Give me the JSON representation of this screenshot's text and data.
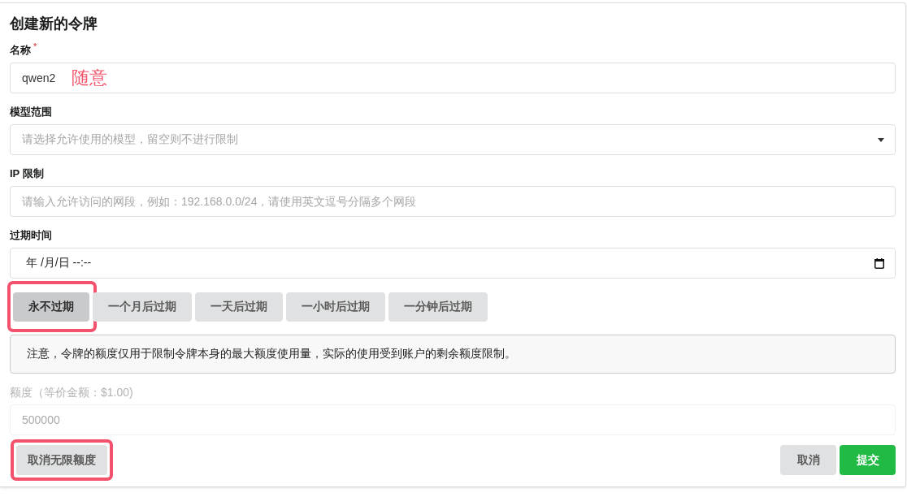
{
  "dialog": {
    "title": "创建新的令牌"
  },
  "fields": [
    {
      "kind": "text",
      "label": "名称",
      "required_mark": "*",
      "value": "qwen2",
      "annotation": "随意"
    },
    {
      "kind": "select",
      "label": "模型范围",
      "placeholder": "请选择允许使用的模型，留空则不进行限制"
    },
    {
      "kind": "text",
      "label": "IP 限制",
      "placeholder": "请输入允许访问的网段，例如：192.168.0.0/24，请使用英文逗号分隔多个网段"
    },
    {
      "kind": "date",
      "label": "过期时间",
      "value": "年 /月/日 --:--"
    }
  ],
  "expiry_presets": [
    {
      "label": "永不过期",
      "selected": true,
      "highlighted": true
    },
    {
      "label": "一个月后过期",
      "selected": false,
      "highlighted": false
    },
    {
      "label": "一天后过期",
      "selected": false,
      "highlighted": false
    },
    {
      "label": "一小时后过期",
      "selected": false,
      "highlighted": false
    },
    {
      "label": "一分钟后过期",
      "selected": false,
      "highlighted": false
    }
  ],
  "notice": "注意，令牌的额度仅用于限制令牌本身的最大额度使用量，实际的使用受到账户的剩余额度限制。",
  "quota": {
    "label": "额度（等价金额：$1.00)",
    "placeholder": "500000",
    "disabled": true
  },
  "actions": {
    "left": [
      {
        "label": "取消无限额度",
        "kind": "secondary",
        "highlighted": true
      }
    ],
    "right": [
      {
        "label": "取消",
        "kind": "secondary",
        "highlighted": false
      },
      {
        "label": "提交",
        "kind": "primary",
        "highlighted": false
      }
    ]
  }
}
